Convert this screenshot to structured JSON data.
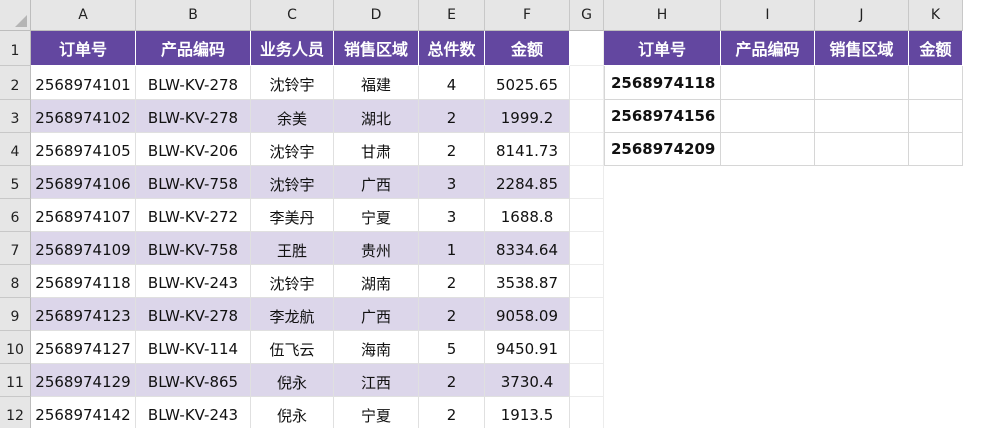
{
  "sheet": {
    "colors": {
      "header_purple": "#6347a0",
      "band_lavender": "#dcd6ea"
    },
    "columns": [
      "A",
      "B",
      "C",
      "D",
      "E",
      "F",
      "G",
      "H",
      "I",
      "J",
      "K"
    ],
    "rows": [
      "1",
      "2",
      "3",
      "4",
      "5",
      "6",
      "7",
      "8",
      "9",
      "10",
      "11",
      "12"
    ],
    "main_headers": [
      "订单号",
      "产品编码",
      "业务人员",
      "销售区域",
      "总件数",
      "金额"
    ],
    "main_rows": [
      [
        "2568974101",
        "BLW-KV-278",
        "沈铃宇",
        "福建",
        "4",
        "5025.65"
      ],
      [
        "2568974102",
        "BLW-KV-278",
        "余美",
        "湖北",
        "2",
        "1999.2"
      ],
      [
        "2568974105",
        "BLW-KV-206",
        "沈铃宇",
        "甘肃",
        "2",
        "8141.73"
      ],
      [
        "2568974106",
        "BLW-KV-758",
        "沈铃宇",
        "广西",
        "3",
        "2284.85"
      ],
      [
        "2568974107",
        "BLW-KV-272",
        "李美丹",
        "宁夏",
        "3",
        "1688.8"
      ],
      [
        "2568974109",
        "BLW-KV-758",
        "王胜",
        "贵州",
        "1",
        "8334.64"
      ],
      [
        "2568974118",
        "BLW-KV-243",
        "沈铃宇",
        "湖南",
        "2",
        "3538.87"
      ],
      [
        "2568974123",
        "BLW-KV-278",
        "李龙航",
        "广西",
        "2",
        "9058.09"
      ],
      [
        "2568974127",
        "BLW-KV-114",
        "伍飞云",
        "海南",
        "5",
        "9450.91"
      ],
      [
        "2568974129",
        "BLW-KV-865",
        "倪永",
        "江西",
        "2",
        "3730.4"
      ],
      [
        "2568974142",
        "BLW-KV-243",
        "倪永",
        "宁夏",
        "2",
        "1913.5"
      ]
    ],
    "lookup_headers": [
      "订单号",
      "产品编码",
      "销售区域",
      "金额"
    ],
    "lookup_rows": [
      [
        "2568974118",
        "",
        "",
        ""
      ],
      [
        "2568974156",
        "",
        "",
        ""
      ],
      [
        "2568974209",
        "",
        "",
        ""
      ]
    ]
  }
}
